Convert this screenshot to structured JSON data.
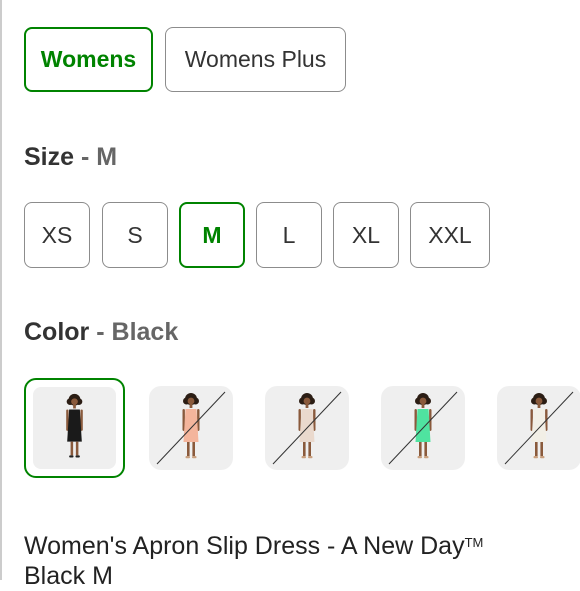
{
  "fit": {
    "options": [
      {
        "label": "Womens",
        "selected": true
      },
      {
        "label": "Womens Plus",
        "selected": false
      }
    ]
  },
  "size": {
    "heading": "Size",
    "separator": "-",
    "selected_value": "M",
    "options": [
      {
        "label": "XS",
        "selected": false
      },
      {
        "label": "S",
        "selected": false
      },
      {
        "label": "M",
        "selected": true
      },
      {
        "label": "L",
        "selected": false
      },
      {
        "label": "XL",
        "selected": false
      },
      {
        "label": "XXL",
        "selected": false
      }
    ]
  },
  "color": {
    "heading": "Color",
    "separator": "-",
    "selected_value": "Black",
    "swatches": [
      {
        "dress_color": "#1a1a1a",
        "selected": true,
        "available": true
      },
      {
        "dress_color": "#f4b59c",
        "selected": false,
        "available": false
      },
      {
        "dress_color": "#ead9cd",
        "selected": false,
        "available": false
      },
      {
        "dress_color": "#4fe3a0",
        "selected": false,
        "available": false
      },
      {
        "dress_color": "#f2efe6",
        "selected": false,
        "available": false
      }
    ]
  },
  "product": {
    "title": "Women's Apron Slip Dress - A New Day",
    "trademark": "TM",
    "subtitle": "Black M"
  },
  "colors": {
    "accent": "#008300",
    "border": "#8c8c8c",
    "muted_text": "#666666"
  }
}
